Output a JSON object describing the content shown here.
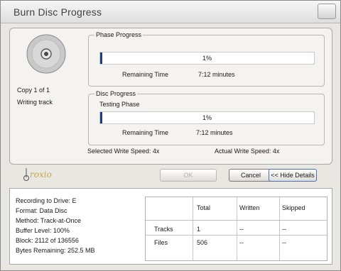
{
  "window": {
    "title": "Burn Disc Progress"
  },
  "status": {
    "copy": "Copy 1 of 1",
    "activity": "Writing track"
  },
  "phase": {
    "title": "Phase Progress",
    "progress_percent": 1,
    "percent_text": "1%",
    "remaining_label": "Remaining Time",
    "remaining_value": "7:12 minutes"
  },
  "disc": {
    "title": "Disc Progress",
    "phase_name": "Testing Phase",
    "progress_percent": 1,
    "percent_text": "1%",
    "remaining_label": "Remaining Time",
    "remaining_value": "7:12 minutes"
  },
  "speed": {
    "selected": "Selected Write Speed: 4x",
    "actual": "Actual Write Speed: 4x"
  },
  "logo": {
    "text": "roxio"
  },
  "buttons": {
    "ok": "OK",
    "cancel": "Cancel",
    "hide_details": "<< Hide Details"
  },
  "details": {
    "lines": [
      "Recording to Drive: E",
      "Format: Data Disc",
      "Method: Track-at-Once",
      "Buffer Level:  100%",
      "Block:    2112 of 136556",
      "Bytes Remaining:    252.5 MB"
    ],
    "table": {
      "headers": [
        "Total",
        "Written",
        "Skipped"
      ],
      "rows": [
        {
          "label": "Tracks",
          "cells": [
            "1",
            "--",
            "--"
          ]
        },
        {
          "label": "Files",
          "cells": [
            "506",
            "--",
            "--"
          ]
        }
      ]
    }
  },
  "colors": {
    "progress_fill": "#1f3f7a",
    "hide_button_border": "#4a6fc0",
    "logo": "#c8a54a"
  }
}
